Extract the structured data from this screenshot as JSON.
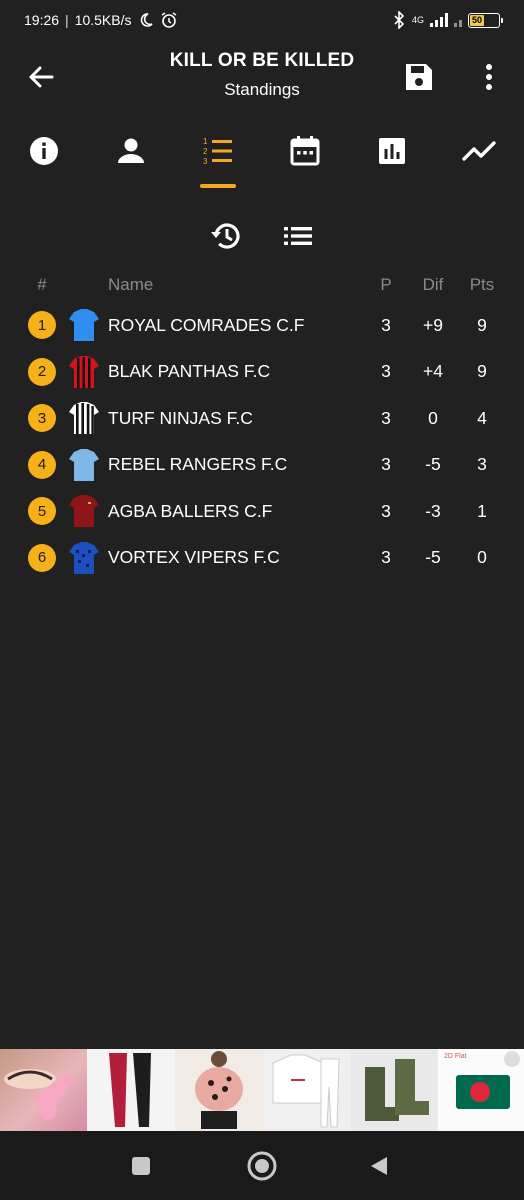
{
  "status_bar": {
    "time": "19:26",
    "speed": "10.5KB/s",
    "network": "4G",
    "battery": "50",
    "icons": [
      "moon-icon",
      "alarm-icon",
      "bluetooth-icon",
      "signal-icon",
      "battery-icon"
    ]
  },
  "header": {
    "title": "KILL OR BE KILLED",
    "subtitle": "Standings",
    "icons": [
      "back-arrow-icon",
      "save-icon",
      "more-vert-icon"
    ]
  },
  "tabs": [
    {
      "icon": "info-icon",
      "active": false
    },
    {
      "icon": "person-icon",
      "active": false
    },
    {
      "icon": "ordered-list-icon",
      "active": true
    },
    {
      "icon": "calendar-icon",
      "active": false
    },
    {
      "icon": "bar-chart-icon",
      "active": false
    },
    {
      "icon": "trend-line-icon",
      "active": false
    }
  ],
  "view_toggles": [
    "history-icon",
    "list-icon"
  ],
  "table": {
    "columns": {
      "rank": "#",
      "name": "Name",
      "played": "P",
      "diff": "Dif",
      "points": "Pts"
    },
    "rows": [
      {
        "rank": "1",
        "team": "ROYAL COMRADES C.F",
        "p": "3",
        "dif": "+9",
        "pts": "9",
        "kit": "blue-kit"
      },
      {
        "rank": "2",
        "team": "BLAK PANTHAS F.C",
        "p": "3",
        "dif": "+4",
        "pts": "9",
        "kit": "red-black-stripes-kit"
      },
      {
        "rank": "3",
        "team": "TURF NINJAS F.C",
        "p": "3",
        "dif": "0",
        "pts": "4",
        "kit": "black-white-stripes-kit"
      },
      {
        "rank": "4",
        "team": "REBEL RANGERS F.C",
        "p": "3",
        "dif": "-5",
        "pts": "3",
        "kit": "sky-blue-kit"
      },
      {
        "rank": "5",
        "team": "AGBA BALLERS C.F",
        "p": "3",
        "dif": "-3",
        "pts": "1",
        "kit": "maroon-kit"
      },
      {
        "rank": "6",
        "team": "VORTEX VIPERS F.C",
        "p": "3",
        "dif": "-5",
        "pts": "0",
        "kit": "blue-pattern-kit"
      }
    ]
  },
  "ads": {
    "last_badge": "2D Flat"
  },
  "colors": {
    "background": "#212121",
    "accent": "#f5a623",
    "badge": "#f5b01a",
    "muted_text": "#8a8a8a"
  }
}
